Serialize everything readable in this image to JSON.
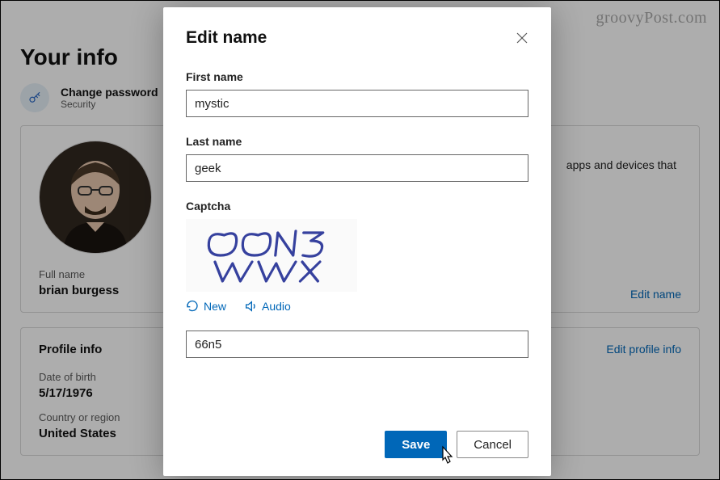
{
  "watermark": "groovyPost.com",
  "page": {
    "title": "Your info",
    "change_password": {
      "label": "Change password",
      "sub": "Security"
    },
    "card_name": {
      "side_text": "apps and devices that",
      "full_name_label": "Full name",
      "full_name_value": "brian burgess",
      "edit_link": "Edit name"
    },
    "card_profile": {
      "header": "Profile info",
      "edit_link": "Edit profile info",
      "dob_label": "Date of birth",
      "dob_value": "5/17/1976",
      "country_label": "Country or region",
      "country_value": "United States"
    }
  },
  "dialog": {
    "title": "Edit name",
    "first_name_label": "First name",
    "first_name_value": "mystic",
    "last_name_label": "Last name",
    "last_name_value": "geek",
    "captcha_label": "Captcha",
    "captcha_text": "66N5 WWX",
    "captcha_new": "New",
    "captcha_audio": "Audio",
    "captcha_input_value": "66n5",
    "save": "Save",
    "cancel": "Cancel"
  }
}
